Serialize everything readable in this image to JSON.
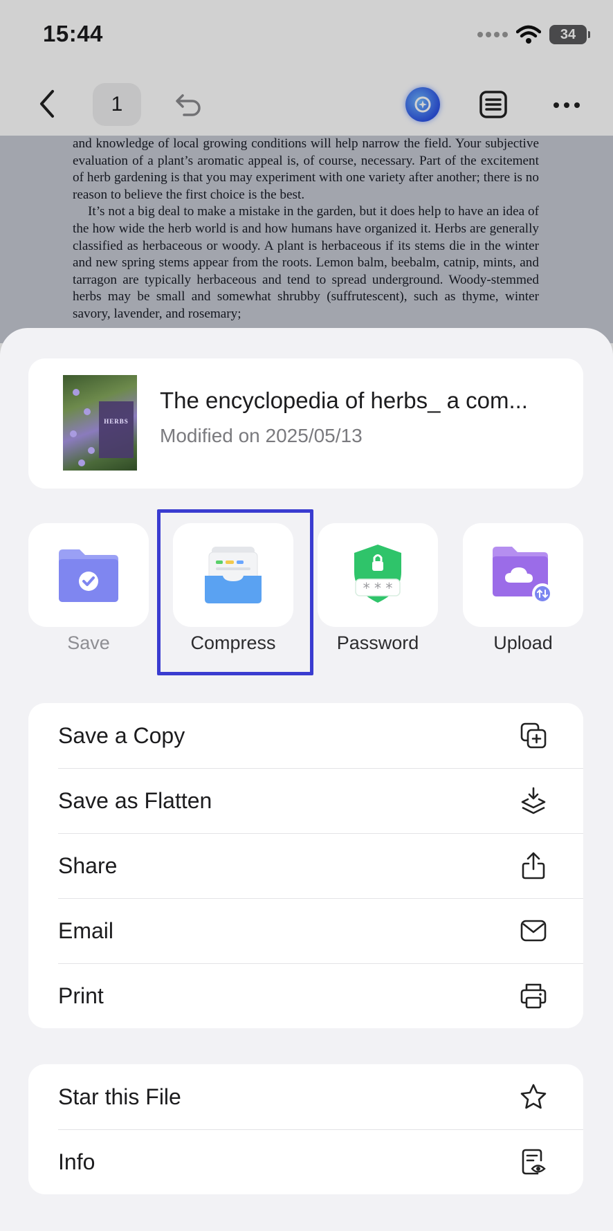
{
  "status_bar": {
    "time": "15:44",
    "battery": "34"
  },
  "toolbar": {
    "page_number": "1"
  },
  "document": {
    "paragraphs": [
      "and knowledge of local growing conditions will help narrow the field. Your subjective evaluation of a plant’s aromatic appeal is, of course, necessary. Part of the excitement of herb gardening is that you may experiment with one variety after another; there is no reason to believe the first choice is the best.",
      "It’s not a big deal to make a mistake in the garden, but it does help to have an idea of the how wide the herb world is and how humans have organized it. Herbs are generally classified as herbaceous or woody. A plant is herbaceous if its stems die in the winter and new spring stems appear from the roots. Lemon balm, beebalm, catnip, mints, and tarragon are typically herbaceous and tend to spread underground. Woody-stemmed herbs may be small and somewhat shrubby (suffrutescent), such as thyme, winter savory, lavender, and rosemary;"
    ]
  },
  "file": {
    "title": "The encyclopedia of herbs_ a com...",
    "modified": "Modified on 2025/05/13",
    "cover_text": "HERBS"
  },
  "actions": [
    {
      "label": "Save",
      "icon": "folder-check-icon",
      "enabled": false
    },
    {
      "label": "Compress",
      "icon": "compress-tray-icon",
      "enabled": true,
      "highlighted": true
    },
    {
      "label": "Password",
      "icon": "shield-lock-icon",
      "enabled": true
    },
    {
      "label": "Upload",
      "icon": "folder-cloud-icon",
      "enabled": true
    }
  ],
  "menu": {
    "main": [
      {
        "label": "Save a Copy",
        "icon": "copy-plus-icon"
      },
      {
        "label": "Save as Flatten",
        "icon": "layers-download-icon"
      },
      {
        "label": "Share",
        "icon": "share-icon"
      },
      {
        "label": "Email",
        "icon": "mail-icon"
      },
      {
        "label": "Print",
        "icon": "printer-icon"
      }
    ],
    "secondary": [
      {
        "label": "Star this File",
        "icon": "star-icon"
      },
      {
        "label": "Info",
        "icon": "info-doc-icon"
      }
    ]
  },
  "colors": {
    "highlight_border": "#3a3cd0",
    "sheet_bg": "#f2f2f5",
    "folder_purple": "#7f86f0",
    "shield_green": "#2fc46a"
  }
}
